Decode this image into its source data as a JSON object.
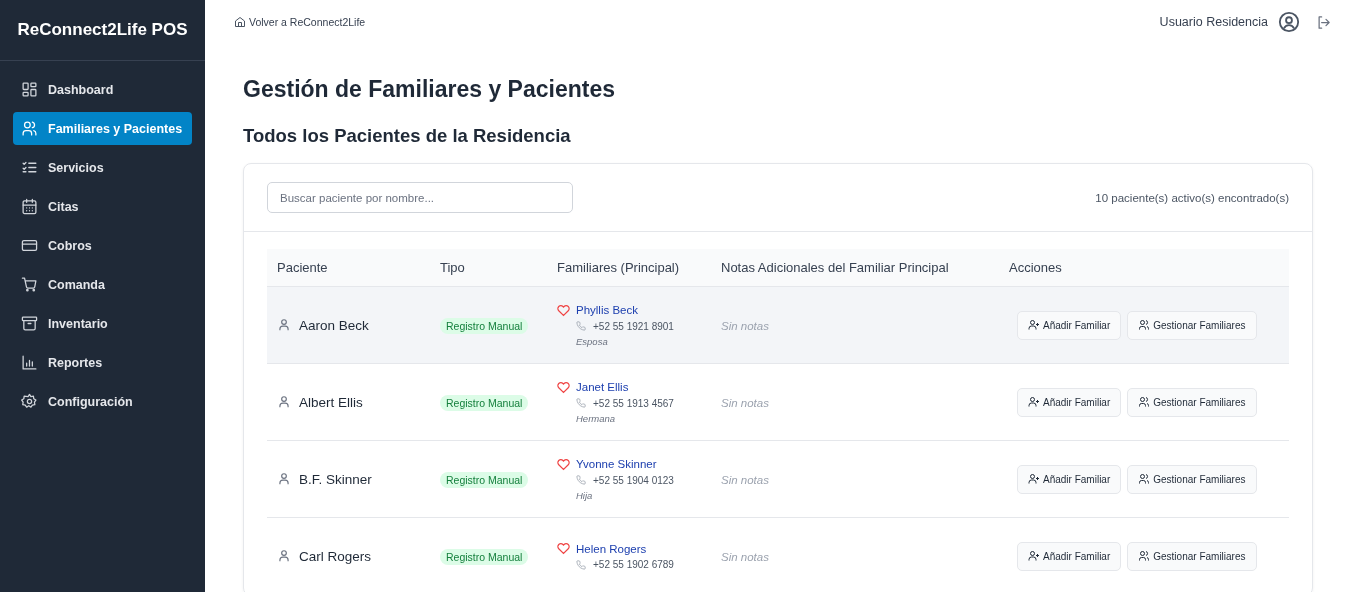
{
  "sidebar": {
    "brand": "ReConnect2Life POS",
    "items": [
      {
        "label": "Dashboard",
        "selected": false
      },
      {
        "label": "Familiares y Pacientes",
        "selected": true
      },
      {
        "label": "Servicios",
        "selected": false
      },
      {
        "label": "Citas",
        "selected": false
      },
      {
        "label": "Cobros",
        "selected": false
      },
      {
        "label": "Comanda",
        "selected": false
      },
      {
        "label": "Inventario",
        "selected": false
      },
      {
        "label": "Reportes",
        "selected": false
      },
      {
        "label": "Configuración",
        "selected": false
      }
    ]
  },
  "header": {
    "back_link": "Volver a ReConnect2Life",
    "user_name": "Usuario Residencia"
  },
  "page_title": "Gestión de Familiares y Pacientes",
  "section_title": "Todos los Pacientes de la Residencia",
  "search": {
    "placeholder": "Buscar paciente por nombre..."
  },
  "result_count": "10 paciente(s) activo(s) encontrado(s)",
  "table": {
    "columns": [
      "Paciente",
      "Tipo",
      "Familiares (Principal)",
      "Notas Adicionales del Familiar Principal",
      "Acciones"
    ],
    "rows": [
      {
        "patient": "Aaron Beck",
        "type": "Registro Manual",
        "family_name": "Phyllis Beck",
        "phone": "+52 55 1921 8901",
        "relation": "Esposa",
        "notes": "Sin notas",
        "actions": [
          "Añadir Familiar",
          "Gestionar Familiares"
        ],
        "highlighted": true
      },
      {
        "patient": "Albert Ellis",
        "type": "Registro Manual",
        "family_name": "Janet Ellis",
        "phone": "+52 55 1913 4567",
        "relation": "Hermana",
        "notes": "Sin notas",
        "actions": [
          "Añadir Familiar",
          "Gestionar Familiares"
        ],
        "highlighted": false
      },
      {
        "patient": "B.F. Skinner",
        "type": "Registro Manual",
        "family_name": "Yvonne Skinner",
        "phone": "+52 55 1904 0123",
        "relation": "Hija",
        "notes": "Sin notas",
        "actions": [
          "Añadir Familiar",
          "Gestionar Familiares"
        ],
        "highlighted": false
      },
      {
        "patient": "Carl Rogers",
        "type": "Registro Manual",
        "family_name": "Helen Rogers",
        "phone": "+52 55 1902 6789",
        "notes": "Sin notas",
        "actions": [
          "Añadir Familiar",
          "Gestionar Familiares"
        ],
        "highlighted": false
      }
    ]
  }
}
